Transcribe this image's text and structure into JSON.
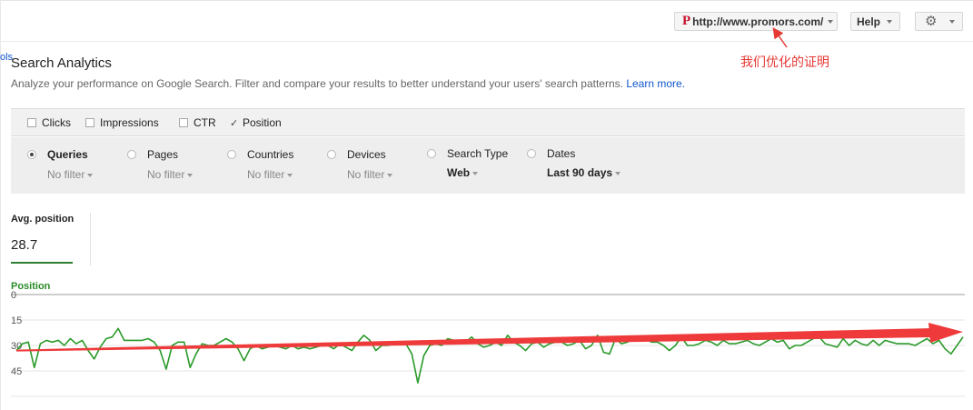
{
  "header": {
    "site_url": "http://www.promors.com/",
    "site_logo_letter": "P",
    "help_label": "Help",
    "settings_icon": "gear-icon",
    "truncated_link": "ols"
  },
  "annotation": {
    "text": "我们优化的证明",
    "color": "#e53935"
  },
  "page": {
    "title": "Search Analytics",
    "subtitle": "Analyze your performance on Google Search. Filter and compare your results to better understand your users' search patterns.",
    "learn_more": "Learn more."
  },
  "metrics": [
    {
      "label": "Clicks",
      "checked": false
    },
    {
      "label": "Impressions",
      "checked": false
    },
    {
      "label": "CTR",
      "checked": false
    },
    {
      "label": "Position",
      "checked": true
    }
  ],
  "filters": [
    {
      "label": "Queries",
      "value": "No filter",
      "selected": true
    },
    {
      "label": "Pages",
      "value": "No filter",
      "selected": false
    },
    {
      "label": "Countries",
      "value": "No filter",
      "selected": false
    },
    {
      "label": "Devices",
      "value": "No filter",
      "selected": false
    },
    {
      "label": "Search Type",
      "value": "Web",
      "selected": false
    },
    {
      "label": "Dates",
      "value": "Last 90 days",
      "selected": false
    }
  ],
  "summary": {
    "label": "Avg. position",
    "value": "28.7"
  },
  "chart_data": {
    "type": "line",
    "series": [
      {
        "name": "Position",
        "color": "#2a9a2a",
        "values": [
          33,
          29,
          28,
          43,
          29,
          27,
          28,
          27,
          30,
          26,
          29,
          27,
          33,
          38,
          31,
          26,
          25,
          20,
          27,
          27,
          27,
          27,
          26,
          28,
          33,
          44,
          30,
          28,
          28,
          43,
          35,
          29,
          30,
          30,
          28,
          26,
          28,
          32,
          39,
          32,
          30,
          32,
          31,
          30,
          31,
          32,
          30,
          32,
          31,
          32,
          31,
          30,
          30,
          32,
          29,
          31,
          33,
          28,
          24,
          27,
          33,
          30,
          30,
          29,
          28,
          29,
          35,
          52,
          36,
          30,
          29,
          30,
          26,
          27,
          28,
          28,
          25,
          29,
          31,
          30,
          28,
          30,
          24,
          28,
          30,
          33,
          29,
          28,
          31,
          29,
          28,
          28,
          30,
          29,
          27,
          32,
          30,
          24,
          34,
          35,
          26,
          29,
          28,
          26,
          27,
          26,
          28,
          28,
          30,
          33,
          30,
          25,
          30,
          30,
          29,
          27,
          28,
          30,
          27,
          29,
          29,
          28,
          27,
          29,
          30,
          28,
          26,
          28,
          27,
          32,
          30,
          30,
          28,
          26,
          25,
          29,
          30,
          31,
          26,
          30,
          27,
          29,
          30,
          27,
          30,
          27,
          28,
          29,
          29,
          29,
          30,
          28,
          26,
          29,
          27,
          32,
          35,
          30,
          25
        ]
      }
    ],
    "y_ticks": [
      0,
      15,
      30,
      45
    ],
    "ylim": [
      0,
      60
    ],
    "y_inverted": true,
    "series_label": "Position",
    "trend_arrow_color": "#ee3a3a"
  }
}
